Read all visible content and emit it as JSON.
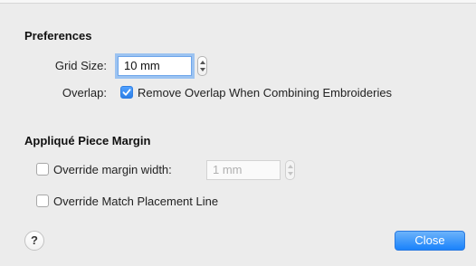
{
  "preferences": {
    "title": "Preferences",
    "grid_size_label": "Grid Size:",
    "grid_size_value": "10 mm",
    "overlap_label": "Overlap:",
    "remove_overlap_label": "Remove Overlap When Combining Embroideries",
    "remove_overlap_checked": true
  },
  "applique": {
    "title": "Appliqué Piece Margin",
    "override_margin_label": "Override margin width:",
    "override_margin_checked": false,
    "margin_value": "1 mm",
    "override_placement_label": "Override Match Placement Line",
    "override_placement_checked": false
  },
  "footer": {
    "help_label": "?",
    "close_label": "Close"
  },
  "icons": {
    "help": "question-mark-icon",
    "check": "checkmark-icon",
    "stepper": "stepper-arrows-icon"
  },
  "colors": {
    "accent": "#1a82fb",
    "focus_ring": "#9cc3f1",
    "background": "#ececec"
  }
}
